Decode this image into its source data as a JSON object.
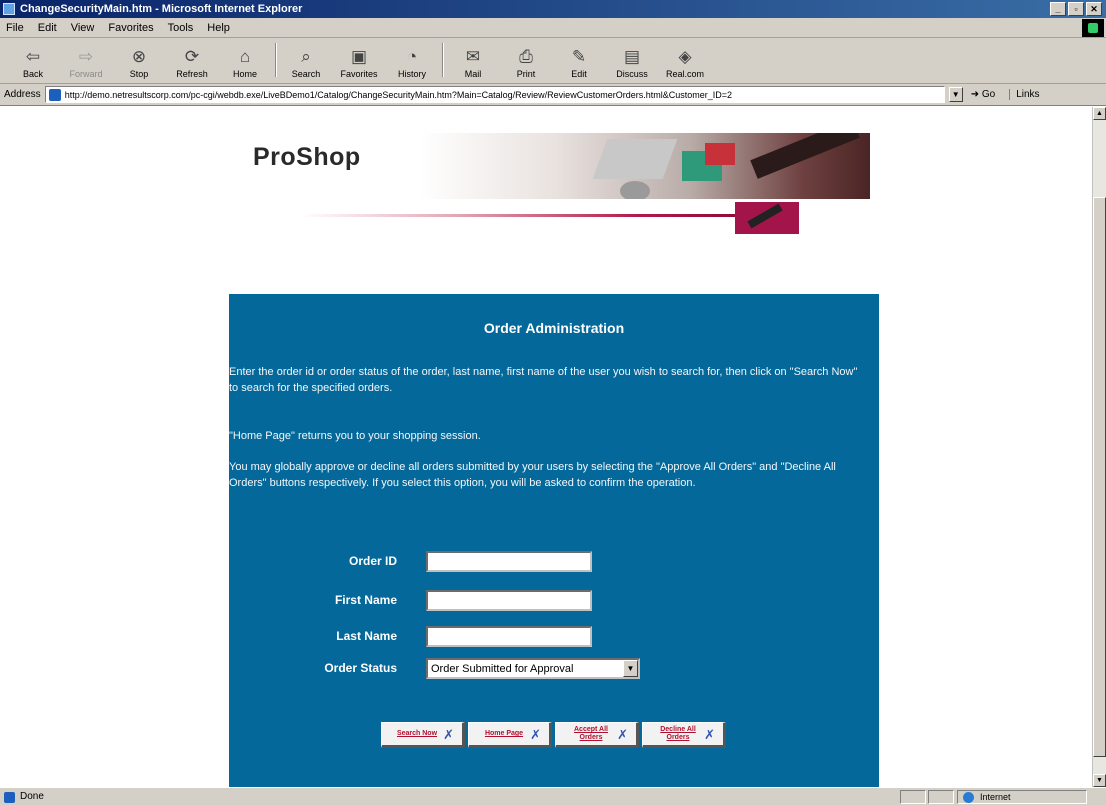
{
  "window": {
    "title": "ChangeSecurityMain.htm - Microsoft Internet Explorer",
    "buttons": [
      "_",
      "▫",
      "✕"
    ]
  },
  "menu": [
    "File",
    "Edit",
    "View",
    "Favorites",
    "Tools",
    "Help"
  ],
  "toolbar": {
    "back": "Back",
    "forward": "Forward",
    "stop": "Stop",
    "refresh": "Refresh",
    "home": "Home",
    "search": "Search",
    "favorites": "Favorites",
    "history": "History",
    "mail": "Mail",
    "print": "Print",
    "edit": "Edit",
    "discuss": "Discuss",
    "realcom": "Real.com"
  },
  "address": {
    "label": "Address",
    "url": "http://demo.netresultscorp.com/pc-cgi/webdb.exe/LiveBDemo1/Catalog/ChangeSecurityMain.htm?Main=Catalog/Review/ReviewCustomerOrders.html&Customer_ID=2",
    "go": "Go",
    "links": "Links"
  },
  "site": {
    "logo": "ProShop"
  },
  "panel": {
    "title": "Order Administration",
    "para1": "Enter the order id or order status of the order, last name, first name of the user you wish to search for, then click on \"Search Now\" to search for the specified orders.",
    "para2": "\"Home Page\" returns you to your shopping session.",
    "para3": "You may globally approve or decline all orders submitted by your users by selecting the \"Approve All Orders\" and \"Decline All Orders\" buttons respectively. If you select this option, you will be asked to confirm the operation.",
    "fields": {
      "order_id": {
        "label": "Order ID",
        "value": ""
      },
      "first_name": {
        "label": "First Name",
        "value": ""
      },
      "last_name": {
        "label": "Last Name",
        "value": ""
      },
      "order_status": {
        "label": "Order Status",
        "value": "Order Submitted for Approval"
      }
    },
    "buttons": {
      "search": "Search Now",
      "home": "Home Page",
      "accept": "Accept All Orders",
      "decline": "Decline All Orders"
    }
  },
  "status": {
    "text": "Done",
    "zone": "Internet"
  }
}
